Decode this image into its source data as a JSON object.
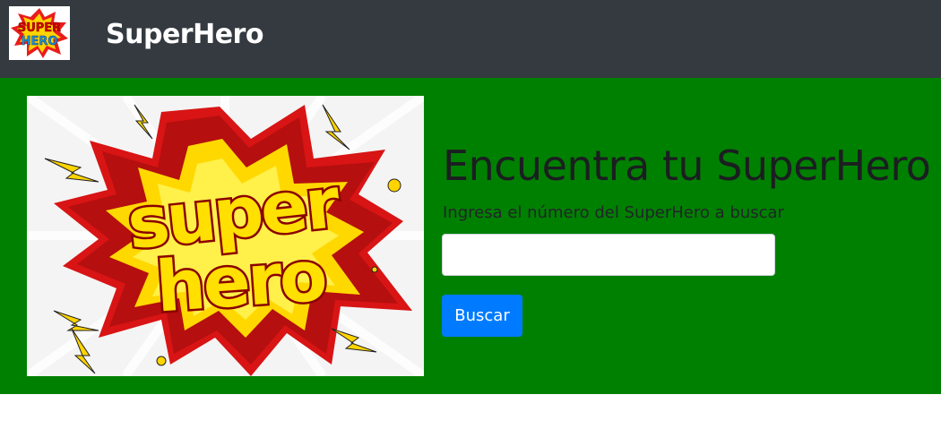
{
  "navbar": {
    "brand": "SuperHero",
    "logo_text_top": "SUPER",
    "logo_text_bottom": "HERO"
  },
  "hero": {
    "image_text_line1": "super",
    "image_text_line2": "hero",
    "title": "Encuentra tu SuperHero",
    "subtitle": "Ingresa el número del SuperHero a buscar",
    "search_value": "",
    "search_placeholder": "",
    "button_label": "Buscar"
  },
  "colors": {
    "navbar_bg": "#343a40",
    "hero_bg": "#008000",
    "button_bg": "#007bff",
    "title_text": "#1b1e21"
  }
}
